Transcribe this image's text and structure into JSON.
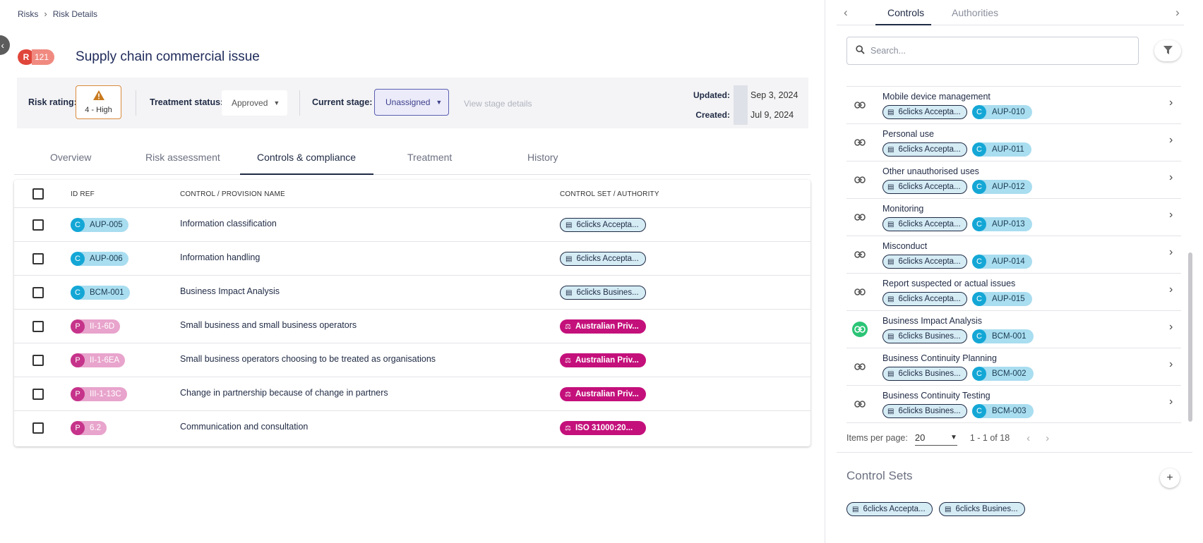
{
  "breadcrumb": {
    "root": "Risks",
    "current": "Risk Details"
  },
  "risk": {
    "prefix": "R",
    "number": "121",
    "title": "Supply chain commercial issue"
  },
  "summary": {
    "rating_label": "Risk rating:",
    "rating_value": "4 - High",
    "treatment_label": "Treatment status:",
    "treatment_value": "Approved",
    "stage_label": "Current stage:",
    "stage_value": "Unassigned",
    "stage_link": "View stage details",
    "updated_label": "Updated:",
    "updated_value": "Sep 3, 2024",
    "created_label": "Created:",
    "created_value": "Jul 9, 2024"
  },
  "tabs": [
    "Overview",
    "Risk assessment",
    "Controls & compliance",
    "Treatment",
    "History"
  ],
  "active_tab": "Controls & compliance",
  "table": {
    "headers": {
      "id": "ID REF",
      "name": "CONTROL / PROVISION NAME",
      "set": "CONTROL SET / AUTHORITY"
    },
    "rows": [
      {
        "type": "C",
        "id": "AUP-005",
        "name": "Information classification",
        "set": "6clicks Accepta...",
        "set_kind": "doc"
      },
      {
        "type": "C",
        "id": "AUP-006",
        "name": "Information handling",
        "set": "6clicks Accepta...",
        "set_kind": "doc"
      },
      {
        "type": "C",
        "id": "BCM-001",
        "name": "Business Impact Analysis",
        "set": "6clicks Busines...",
        "set_kind": "doc"
      },
      {
        "type": "P",
        "id": "II-1-6D",
        "name": "Small business and small business operators",
        "set": "Australian Priv...",
        "set_kind": "auth"
      },
      {
        "type": "P",
        "id": "II-1-6EA",
        "name": "Small business operators choosing to be treated as organisations",
        "set": "Australian Priv...",
        "set_kind": "auth"
      },
      {
        "type": "P",
        "id": "III-1-13C",
        "name": "Change in partnership because of change in partners",
        "set": "Australian Priv...",
        "set_kind": "auth"
      },
      {
        "type": "P",
        "id": "6.2",
        "name": "Communication and consultation",
        "set": "ISO 31000:20...",
        "set_kind": "auth"
      }
    ]
  },
  "panel": {
    "tabs": [
      "Controls",
      "Authorities"
    ],
    "active_tab": "Controls",
    "search_placeholder": "Search...",
    "items": [
      {
        "title": "Mobile device management",
        "set": "6clicks Accepta...",
        "type": "C",
        "id": "AUP-010",
        "linked": false
      },
      {
        "title": "Personal use",
        "set": "6clicks Accepta...",
        "type": "C",
        "id": "AUP-011",
        "linked": false
      },
      {
        "title": "Other unauthorised uses",
        "set": "6clicks Accepta...",
        "type": "C",
        "id": "AUP-012",
        "linked": false
      },
      {
        "title": "Monitoring",
        "set": "6clicks Accepta...",
        "type": "C",
        "id": "AUP-013",
        "linked": false
      },
      {
        "title": "Misconduct",
        "set": "6clicks Accepta...",
        "type": "C",
        "id": "AUP-014",
        "linked": false
      },
      {
        "title": "Report suspected or actual issues",
        "set": "6clicks Accepta...",
        "type": "C",
        "id": "AUP-015",
        "linked": false
      },
      {
        "title": "Business Impact Analysis",
        "set": "6clicks Busines...",
        "type": "C",
        "id": "BCM-001",
        "linked": true
      },
      {
        "title": "Business Continuity Planning",
        "set": "6clicks Busines...",
        "type": "C",
        "id": "BCM-002",
        "linked": false
      },
      {
        "title": "Business Continuity Testing",
        "set": "6clicks Busines...",
        "type": "C",
        "id": "BCM-003",
        "linked": false
      }
    ],
    "pager": {
      "label": "Items per page:",
      "per_page": "20",
      "range": "1 - 1 of 18"
    },
    "control_sets_title": "Control Sets",
    "control_sets": [
      "6clicks Accepta...",
      "6clicks Busines..."
    ]
  },
  "colors": {
    "accent": "#1f2a44",
    "control_tag": "#14a7d6",
    "provision_tag": "#c6338a",
    "authority_pill": "#c4107b",
    "linked": "#2bc476",
    "risk_red": "#e0453a"
  }
}
